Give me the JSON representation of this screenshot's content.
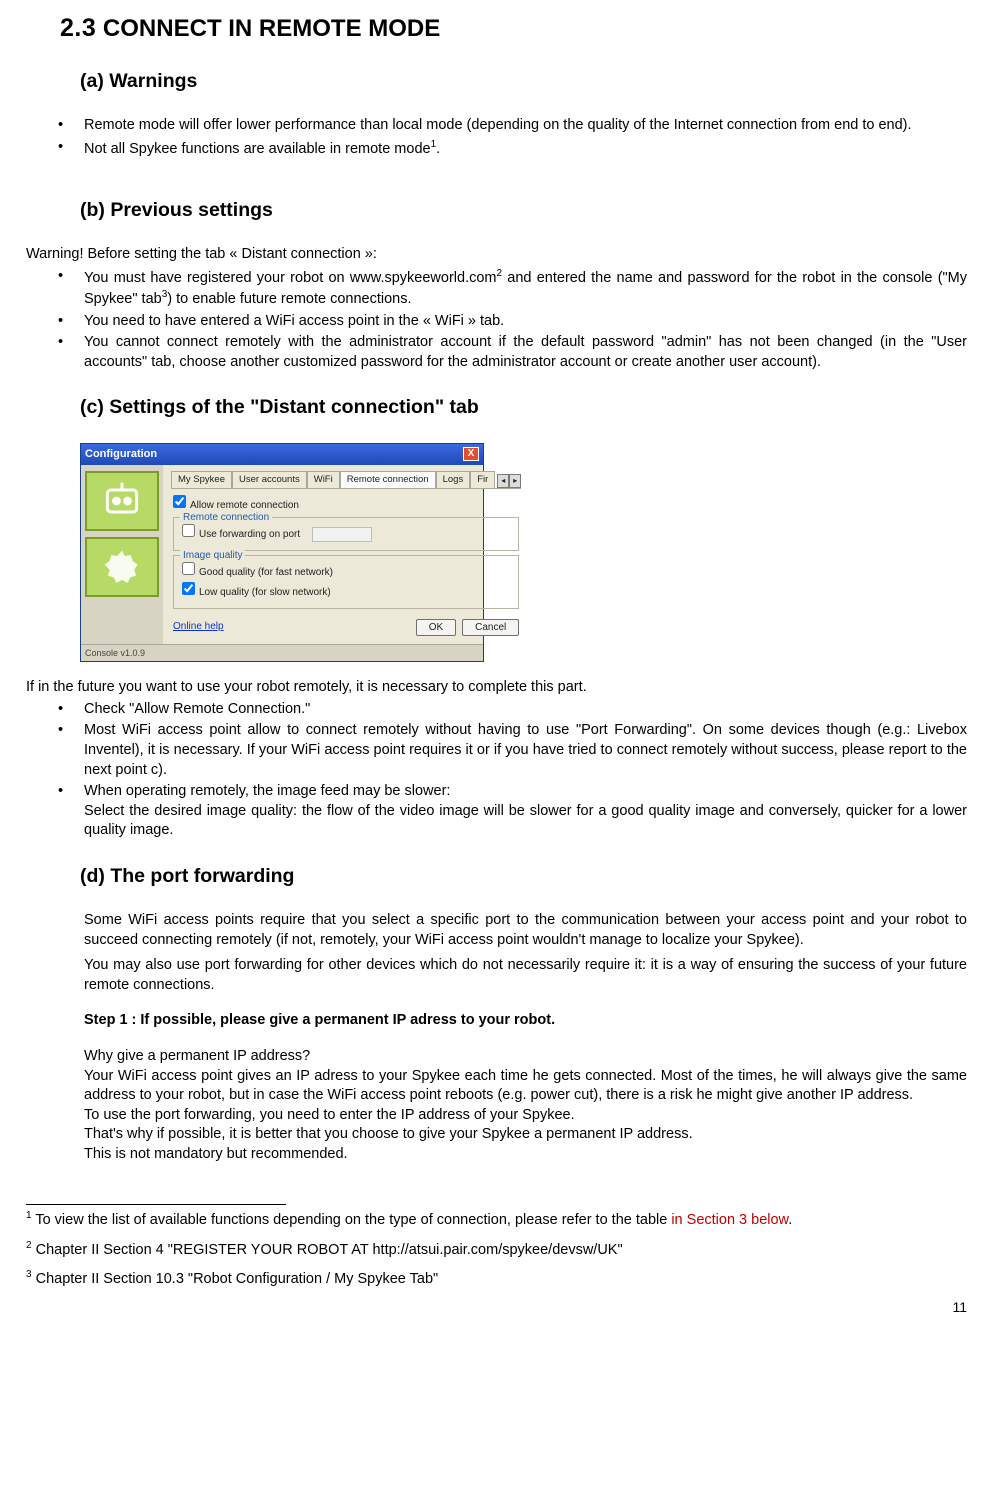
{
  "title_num": "2.3",
  "title_rest": " CONNECT IN REMOTE  MODE",
  "sub_a": "(a) Warnings",
  "bullets_a": [
    "Remote mode will offer lower performance than local mode (depending on the quality of the Internet connection from end to end).",
    "Not all Spykee functions are available in remote mode"
  ],
  "sup1": "1",
  "dot": ".",
  "sub_b": "(b) Previous settings",
  "warn_intro": "Warning! Before setting the tab « Distant connection »:",
  "bullets_b_1a": "You must have registered your robot on www.spykeeworld.com",
  "sup2": "2",
  "bullets_b_1b": " and entered the name and password for the robot in the console (\"My Spykee\" tab",
  "sup3": "3",
  "bullets_b_1c": ") to enable future remote connections.",
  "bullets_b_2": "You need to have entered a WiFi access point in the « WiFi » tab.",
  "bullets_b_3": "You cannot connect remotely with the administrator account if the default password \"admin\" has not been changed (in the \"User accounts\" tab, choose another customized password for the administrator account or create another user account).",
  "sub_c": "(c) Settings of the \"Distant connection\" tab",
  "cfg": {
    "title": "Configuration",
    "close": "X",
    "tabs": [
      "My Spykee",
      "User accounts",
      "WiFi",
      "Remote connection",
      "Logs",
      "Fir"
    ],
    "arrow_l": "◂",
    "arrow_r": "▸",
    "allow": "Allow remote connection",
    "grp_remote": "Remote connection",
    "use_fwd": "Use forwarding on port",
    "grp_img": "Image quality",
    "good": "Good quality (for fast network)",
    "low": "Low quality (for slow network)",
    "help": "Online help",
    "ok": "OK",
    "cancel": "Cancel",
    "footer": "Console v1.0.9"
  },
  "c_intro": "If in the future you want to use your robot remotely, it is necessary to complete this part.",
  "bullets_c_1": "Check \"Allow Remote Connection.\"",
  "bullets_c_2": "Most WiFi access point allow to connect remotely without having to use \"Port Forwarding\". On some devices though (e.g.: Livebox Inventel), it is necessary. If your WiFi access point requires it or if you have tried to connect remotely without success, please report to the next point c).",
  "bullets_c_3a": "When operating remotely, the image feed may be slower:",
  "bullets_c_3b": "Select the desired image quality: the flow of the video image will be slower for a good quality image and conversely, quicker for a lower quality image.",
  "sub_d": "(d) The port forwarding",
  "d_p1": "Some WiFi access points require that you select a specific port to the communication between your access point and your robot to succeed connecting remotely (if not, remotely, your WiFi access point wouldn't manage to localize your Spykee).",
  "d_p2": "You may also use port forwarding for other devices which do not necessarily require it: it is a way of ensuring the success of your future remote connections.",
  "d_step1": "Step 1 : If possible, please give a permanent IP adress to your robot.",
  "d_q": "Why give a permanent IP address?",
  "d_p3": "Your WiFi access point gives an IP adress to your Spykee each time he gets connected. Most of the times, he will always give the same address to your robot, but in case the WiFi access point reboots (e.g. power cut), there is a risk he might give another IP address.",
  "d_p4": "To use the port forwarding, you need to enter the IP address of your Spykee.",
  "d_p5": "That's why if possible, it is better that you choose to give your Spykee a permanent IP address.",
  "d_p6": "This is not mandatory but recommended.",
  "fn1_pre": " To view the list of available functions depending on the type of connection, please refer to the table ",
  "fn1_red": "in Section 3 below",
  "fn1_post": ".",
  "fn2": " Chapter II Section 4 \"REGISTER YOUR ROBOT AT http://atsui.pair.com/spykee/devsw/UK\"",
  "fn3": " Chapter II Section 10.3 \"Robot Configuration / My Spykee Tab\"",
  "page": "11"
}
